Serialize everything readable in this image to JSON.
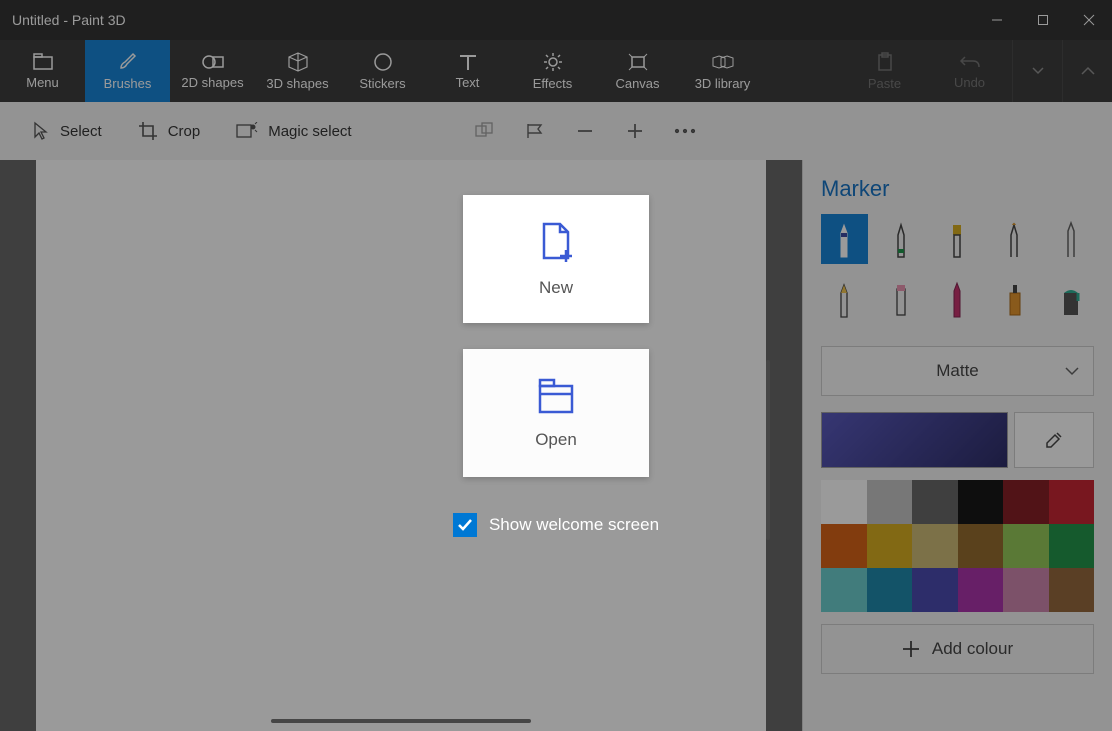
{
  "window": {
    "title": "Untitled - Paint 3D"
  },
  "ribbon": {
    "menu": "Menu",
    "brushes": "Brushes",
    "shapes2d": "2D shapes",
    "shapes3d": "3D shapes",
    "stickers": "Stickers",
    "text": "Text",
    "effects": "Effects",
    "canvas": "Canvas",
    "library3d": "3D library",
    "paste": "Paste",
    "undo": "Undo"
  },
  "tools": {
    "select": "Select",
    "crop": "Crop",
    "magic": "Magic select"
  },
  "side": {
    "title": "Marker",
    "material": "Matte",
    "add_colour": "Add colour",
    "current_color": "#3a3aa8",
    "palette": [
      "#ffffff",
      "#bfbfbf",
      "#595959",
      "#000000",
      "#7a0a11",
      "#c1121f",
      "#d35400",
      "#d4a60b",
      "#c9b56b",
      "#8b5e1a",
      "#8bc34a",
      "#0e8a3a",
      "#5ec8c8",
      "#0a7ea4",
      "#3a3aa8",
      "#a31fa3",
      "#c97ba6",
      "#8b5a2b"
    ]
  },
  "dialog": {
    "new": "New",
    "open": "Open",
    "show_welcome": "Show welcome screen"
  }
}
